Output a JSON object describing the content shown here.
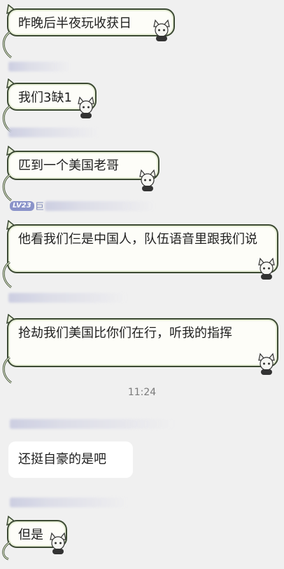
{
  "messages": [
    {
      "text": "昨晚后半夜玩收获日"
    },
    {
      "text": "我们3缺1"
    },
    {
      "text": "匹到一个美国老哥"
    },
    {
      "text": "他看我们仨是中国人，队伍语音里跟我们说"
    },
    {
      "text": "抢劫我们美国比你们在行，听我的指挥"
    },
    {
      "text": "还挺自豪的是吧"
    },
    {
      "text": "但是"
    }
  ],
  "sender_badge": {
    "level": "LV23",
    "name_char": "巨"
  },
  "timestamp": "11:24",
  "colors": {
    "background": "#f0f0f0",
    "bubble_border": "#3c4a33",
    "bubble_fill": "#fdfdf8",
    "badge": "#8a93c9"
  },
  "icons": [
    "cat-ear-icon",
    "cat-tail-icon",
    "chibi-cat-sticker-icon"
  ]
}
